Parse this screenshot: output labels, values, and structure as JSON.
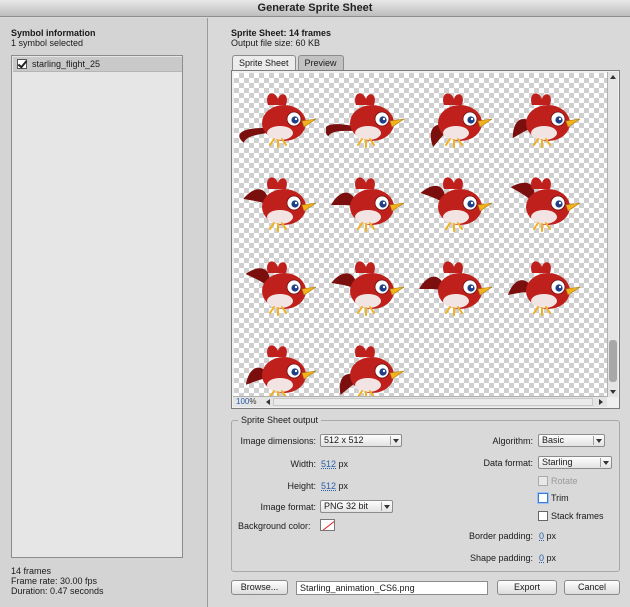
{
  "window": {
    "title": "Generate Sprite Sheet"
  },
  "left": {
    "heading": "Symbol information",
    "subheading": "1 symbol selected",
    "symbols": [
      {
        "name": "starling_flight_25",
        "checked": true
      }
    ],
    "stats": {
      "frames": "14 frames",
      "frame_rate": "Frame rate: 30.00 fps",
      "duration": "Duration: 0.47 seconds"
    }
  },
  "sheet": {
    "title": "Sprite Sheet: 14 frames",
    "file_size": "Output file size: 60 KB",
    "tabs": [
      {
        "label": "Sprite Sheet",
        "active": true
      },
      {
        "label": "Preview",
        "active": false
      }
    ],
    "zoom": "100",
    "zoom_unit": "%",
    "frame_count": 14,
    "colors": {
      "body": "#c0201c",
      "dark": "#7a0f0e",
      "belly": "#f3e4e4",
      "beak": "#f2b21b",
      "eye": "#1d3e86"
    }
  },
  "output": {
    "group_title": "Sprite Sheet output",
    "image_dimensions": {
      "label": "Image dimensions:",
      "value": "512 x 512"
    },
    "width": {
      "label": "Width:",
      "value": "512",
      "unit": "px"
    },
    "height": {
      "label": "Height:",
      "value": "512",
      "unit": "px"
    },
    "image_format": {
      "label": "Image format:",
      "value": "PNG 32 bit"
    },
    "background_color": {
      "label": "Background color:"
    },
    "algorithm": {
      "label": "Algorithm:",
      "value": "Basic"
    },
    "data_format": {
      "label": "Data format:",
      "value": "Starling"
    },
    "rotate": {
      "label": "Rotate",
      "checked": false,
      "disabled": true
    },
    "trim": {
      "label": "Trim",
      "checked": false
    },
    "stack_frames": {
      "label": "Stack frames",
      "checked": false
    },
    "border_padding": {
      "label": "Border padding:",
      "value": "0",
      "unit": "px"
    },
    "shape_padding": {
      "label": "Shape padding:",
      "value": "0",
      "unit": "px"
    }
  },
  "footer": {
    "browse_label": "Browse...",
    "output_path": "Starling_animation_CS6.png",
    "export_label": "Export",
    "cancel_label": "Cancel"
  }
}
